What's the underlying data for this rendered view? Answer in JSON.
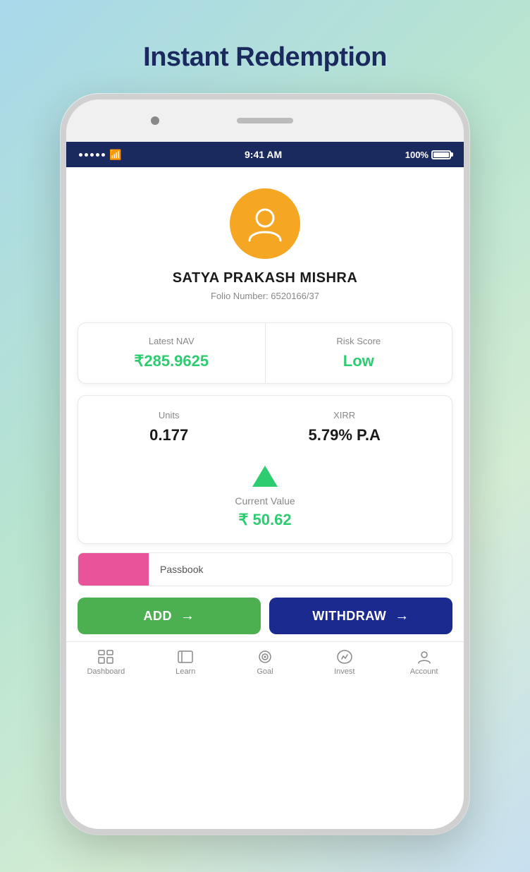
{
  "page": {
    "title": "Instant Redemption",
    "background_colors": {
      "gradient_start": "#a8d8ea",
      "gradient_end": "#c8dff0"
    }
  },
  "status_bar": {
    "time": "9:41 AM",
    "battery": "100%",
    "signal": "•••••"
  },
  "profile": {
    "name": "SATYA PRAKASH MISHRA",
    "folio_label": "Folio Number:",
    "folio_number": "6520166/37"
  },
  "stats": {
    "nav_label": "Latest NAV",
    "nav_value": "₹285.9625",
    "risk_label": "Risk Score",
    "risk_value": "Low"
  },
  "investment": {
    "units_label": "Units",
    "units_value": "0.177",
    "xirr_label": "XIRR",
    "xirr_value": "5.79% P.A",
    "current_value_label": "Current Value",
    "current_value": "₹ 50.62"
  },
  "passbook": {
    "label": "Passbook"
  },
  "buttons": {
    "add_label": "ADD",
    "add_arrow": "→",
    "withdraw_label": "WITHDRAW",
    "withdraw_arrow": "→"
  },
  "nav": {
    "items": [
      {
        "id": "dashboard",
        "label": "Dashboard",
        "icon": "⊞"
      },
      {
        "id": "learn",
        "label": "Learn",
        "icon": "▭"
      },
      {
        "id": "goal",
        "label": "Goal",
        "icon": "◎"
      },
      {
        "id": "invest",
        "label": "Invest",
        "icon": "◇"
      },
      {
        "id": "account",
        "label": "Account",
        "icon": "○"
      }
    ]
  }
}
